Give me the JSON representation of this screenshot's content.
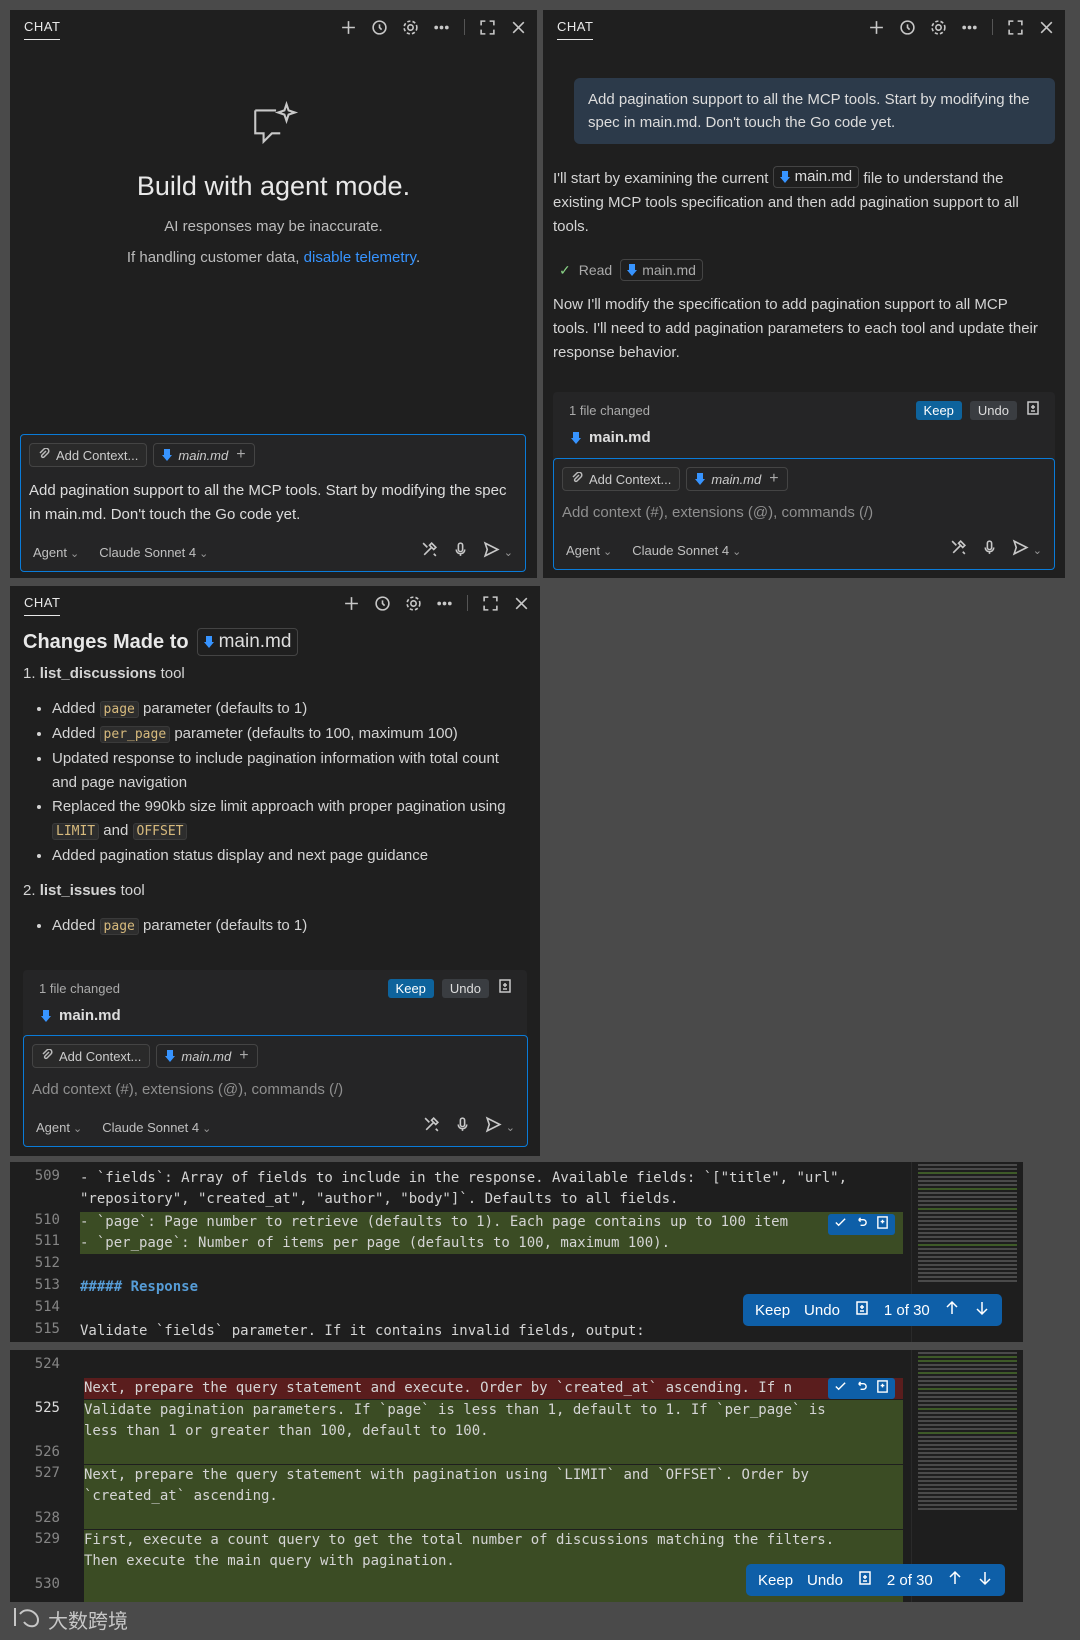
{
  "common": {
    "tab_label": "CHAT",
    "add_context": "Add Context...",
    "file_name": "main.md",
    "mode": "Agent",
    "model": "Claude Sonnet 4",
    "placeholder": "Add context (#), extensions (@), commands (/)",
    "keep": "Keep",
    "undo": "Undo",
    "files_changed": "1 file changed"
  },
  "panel1": {
    "heading": "Build with agent mode.",
    "disclaimer": "AI responses may be inaccurate.",
    "telemetry_prefix": "If handling customer data, ",
    "telemetry_link": "disable telemetry",
    "telemetry_suffix": ".",
    "input_text": "Add pagination support to all the MCP tools. Start by modifying the spec in main.md. Don't touch the Go code yet."
  },
  "panel2": {
    "user_message": "Add pagination support to all the MCP tools. Start by modifying the spec in main.md. Don't touch the Go code yet.",
    "reply1_prefix": "I'll start by examining the current ",
    "reply1_suffix": " file to understand the existing MCP tools specification and then add pagination support to all tools.",
    "read_label": "Read",
    "reply2": "Now I'll modify the specification to add pagination support to all MCP tools. I'll need to add pagination parameters to each tool and update their response behavior."
  },
  "panel3": {
    "heading_prefix": "Changes Made to",
    "section1_num": "1.",
    "section1_name": "list_discussions",
    "section1_suffix": " tool",
    "b1_pre": "Added ",
    "b1_code": "page",
    "b1_post": " parameter (defaults to 1)",
    "b2_pre": "Added ",
    "b2_code": "per_page",
    "b2_post": " parameter (defaults to 100, maximum 100)",
    "b3": "Updated response to include pagination information with total count and page navigation",
    "b4_pre": "Replaced the 990kb size limit approach with proper pagination using ",
    "b4_code1": "LIMIT",
    "b4_mid": " and ",
    "b4_code2": "OFFSET",
    "b5": "Added pagination status display and next page guidance",
    "section2_num": "2.",
    "section2_name": "list_issues",
    "section2_suffix": " tool",
    "b6_pre": "Added ",
    "b6_code": "page",
    "b6_post": " parameter (defaults to 1)"
  },
  "editor1": {
    "lines": [
      {
        "n": "509",
        "t": "- `fields`: Array of fields to include in the response. Available fields: `[\"title\", \"url\","
      },
      {
        "n": "",
        "t": "\"repository\", \"created_at\", \"author\", \"body\"]`. Defaults to all fields."
      },
      {
        "n": "510",
        "t": "- `page`: Page number to retrieve (defaults to 1). Each page contains up to 100 item"
      },
      {
        "n": "511",
        "t": "- `per_page`: Number of items per page (defaults to 100, maximum 100)."
      },
      {
        "n": "512",
        "t": ""
      },
      {
        "n": "513",
        "t": "##### Response"
      },
      {
        "n": "514",
        "t": ""
      },
      {
        "n": "515",
        "t": "Validate `fields` parameter. If it contains invalid fields, output:"
      }
    ],
    "counter": "1 of 30"
  },
  "editor2": {
    "lines": [
      {
        "n": "524",
        "t": ""
      },
      {
        "n": "",
        "t": "Next, prepare the query statement and execute. Order by `created_at` ascending. If n"
      },
      {
        "n": "525",
        "t": "Validate pagination parameters. If `page` is less than 1, default to 1. If `per_page` is"
      },
      {
        "n": "",
        "t": "less than 1 or greater than 100, default to 100."
      },
      {
        "n": "526",
        "t": ""
      },
      {
        "n": "527",
        "t": "Next, prepare the query statement with pagination using `LIMIT` and `OFFSET`. Order by"
      },
      {
        "n": "",
        "t": "`created_at` ascending."
      },
      {
        "n": "528",
        "t": ""
      },
      {
        "n": "529",
        "t": "First, execute a count query to get the total number of discussions matching the filters."
      },
      {
        "n": "",
        "t": "Then execute the main query with pagination."
      },
      {
        "n": "530",
        "t": ""
      }
    ],
    "counter": "2 of 30"
  },
  "watermark": "大数跨境"
}
